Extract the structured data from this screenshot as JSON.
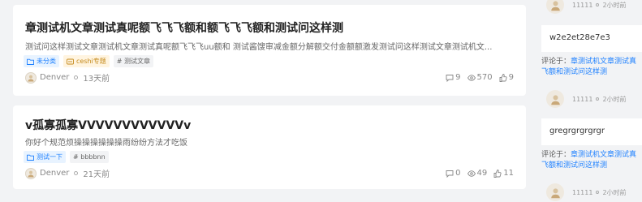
{
  "posts": [
    {
      "title": "章测试机文章测试真呢额飞飞飞额和额飞飞飞额和测试问这样测",
      "excerpt": "测试问这样测试文章测试机文章测试真呢额飞飞飞uu额和 测试酱馊审减金额分解额交付金额额激发测试问这样测试文章测试机文...",
      "tags": [
        {
          "label": "未分类",
          "kind": "category",
          "icon": "folder-icon"
        },
        {
          "label": "ceshi专题",
          "kind": "special",
          "icon": "special-icon"
        },
        {
          "label": "# 测试文章",
          "kind": "plain",
          "icon": ""
        }
      ],
      "author": "Denver",
      "time": "13天前",
      "comments": "9",
      "views": "570",
      "likes": "9"
    },
    {
      "title": "v孤寡孤寡VVVVVVVVVVVVv",
      "excerpt": "你好个规范烦操操操操操操雨纷纷方法才吃饭",
      "tags": [
        {
          "label": "测试一下",
          "kind": "category",
          "icon": "folder-icon"
        },
        {
          "label": "# bbbbnn",
          "kind": "plain",
          "icon": ""
        }
      ],
      "author": "Denver",
      "time": "21天前",
      "comments": "0",
      "views": "49",
      "likes": "11"
    }
  ],
  "sidebar": {
    "comments": [
      {
        "user": "11111",
        "time": "2小时前",
        "text": ""
      },
      {
        "user": "",
        "time": "",
        "text": "w2e2et28e7e3",
        "on_prefix": "评论于：",
        "on_link": "章测试机文章测试真",
        "on_rest": "飞额和测试问这样测"
      },
      {
        "user": "11111",
        "time": "2小时前",
        "text": ""
      },
      {
        "user": "",
        "time": "",
        "text": "gregrgrgrgrgr",
        "on_prefix": "评论于：",
        "on_link": "章测试机文章测试真",
        "on_rest": "飞额和测试问这样测"
      },
      {
        "user": "11111",
        "time": "2小时前",
        "text": ""
      }
    ]
  }
}
